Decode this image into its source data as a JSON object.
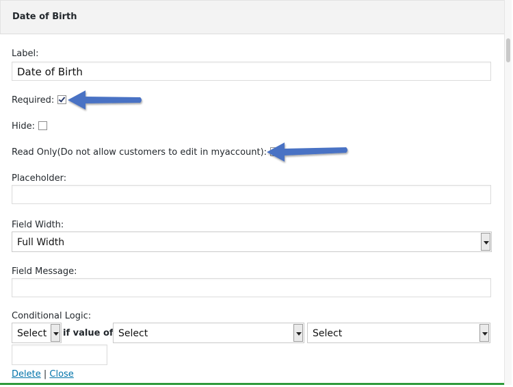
{
  "header": {
    "title": "Date of Birth"
  },
  "fields": {
    "label": {
      "label": "Label:",
      "value": "Date of Birth"
    },
    "required": {
      "label": "Required:",
      "checked": true
    },
    "hide": {
      "label": "Hide:",
      "checked": false
    },
    "read_only": {
      "label": "Read Only(Do not allow customers to edit in myaccount):",
      "checked": true
    },
    "placeholder": {
      "label": "Placeholder:",
      "value": ""
    },
    "field_width": {
      "label": "Field Width:",
      "value": "Full Width"
    },
    "field_message": {
      "label": "Field Message:",
      "value": ""
    },
    "conditional_logic": {
      "label": "Conditional Logic:",
      "select1": "Select",
      "if_value_of": "if value of",
      "select2": "Select",
      "select3": "Select",
      "value": ""
    }
  },
  "actions": {
    "delete": "Delete",
    "separator": "|",
    "close": "Close"
  },
  "colors": {
    "annotation_arrow": "#4a72c4",
    "frame_border": "#2e9a3a",
    "link": "#0073aa"
  }
}
